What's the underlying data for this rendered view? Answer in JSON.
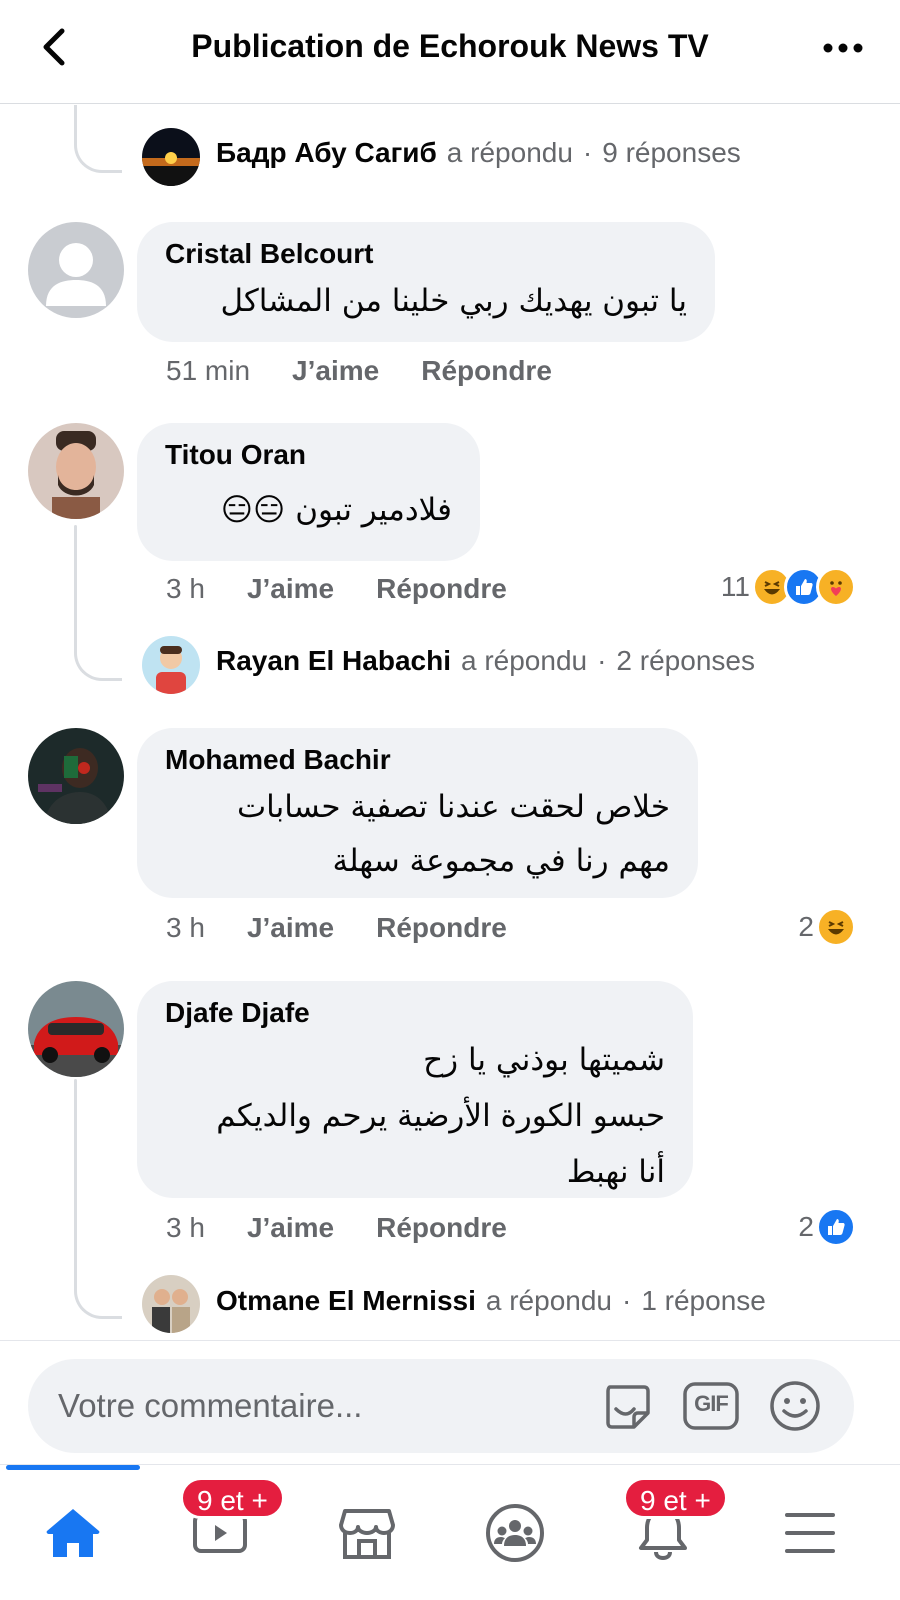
{
  "header": {
    "title": "Publication de Echorouk News TV"
  },
  "comments": [
    {
      "reply_summary": {
        "name": "Бадр Абу Сагиб",
        "verb": "a répondu",
        "separator": "·",
        "count_text": "9 réponses"
      }
    },
    {
      "author": "Cristal Belcourt",
      "text": [
        "يا تبون يهديك ربي خلينا من المشاكل"
      ],
      "time": "51 min",
      "like_label": "J’aime",
      "reply_label": "Répondre"
    },
    {
      "author": "Titou Oran",
      "text": [
        "فلادمير تبون 😑😑"
      ],
      "time": "3 h",
      "like_label": "J’aime",
      "reply_label": "Répondre",
      "reactions": {
        "count": "11",
        "icons": [
          "haha",
          "like",
          "care"
        ]
      },
      "reply_summary": {
        "name": "Rayan El Habachi",
        "verb": "a répondu",
        "separator": "·",
        "count_text": "2 réponses"
      }
    },
    {
      "author": "Mohamed Bachir",
      "text": [
        "خلاص لحقت عندنا تصفية حسابات",
        "مهم رنا في مجموعة سهلة"
      ],
      "time": "3 h",
      "like_label": "J’aime",
      "reply_label": "Répondre",
      "reactions": {
        "count": "2",
        "icons": [
          "haha"
        ]
      }
    },
    {
      "author": "Djafe Djafe",
      "text": [
        "شميتها بوذني يا زح",
        "حبسو الكورة الأرضية يرحم والديكم",
        "أنا نهبط"
      ],
      "time": "3 h",
      "like_label": "J’aime",
      "reply_label": "Répondre",
      "reactions": {
        "count": "2",
        "icons": [
          "like"
        ]
      },
      "reply_summary": {
        "name": "Otmane El Mernissi",
        "verb": "a répondu",
        "separator": "·",
        "count_text": "1 réponse"
      }
    }
  ],
  "composer": {
    "placeholder": "Votre commentaire...",
    "gif_label": "GIF"
  },
  "bottom_nav": {
    "items": [
      "home-icon",
      "watch-icon",
      "marketplace-icon",
      "groups-icon",
      "notifications-icon",
      "menu-icon"
    ],
    "watch_badge": "9 et +",
    "notifications_badge": "9 et +"
  },
  "colors": {
    "accent": "#1877f2",
    "bubble": "#f0f2f5",
    "secondary_text": "#65676b",
    "badge": "#e41e3f"
  }
}
